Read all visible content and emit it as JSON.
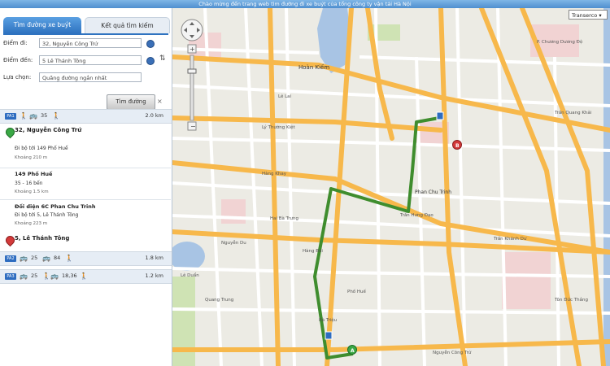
{
  "header": {
    "welcome": "Chào mừng đến trang web tìm đường đi xe buýt của tổng công ty vận tải Hà Nội"
  },
  "tabs": [
    {
      "label": "Tìm đường xe buýt"
    },
    {
      "label": "Kết quả tìm kiếm"
    }
  ],
  "form": {
    "from_label": "Điểm đi:",
    "from_value": "32, Nguyễn Công Trứ",
    "to_label": "Điểm đến:",
    "to_value": "5 Lê Thánh Tông",
    "option_label": "Lựa chọn:",
    "option_value": "Quãng đường ngắn nhất",
    "find_button": "Tìm đường",
    "close": "×",
    "swap": "⇅"
  },
  "routes": [
    {
      "badge": "PA1",
      "bus": "35",
      "distance": "2.0 km"
    },
    {
      "badge": "PA2",
      "bus": "25",
      "bus2": "84",
      "distance": "1.8 km"
    },
    {
      "badge": "PA3",
      "bus": "25",
      "bus2": "18,36",
      "distance": "1.2 km"
    }
  ],
  "steps": {
    "start_title": "32, Nguyễn Công Trứ",
    "walk1": "Đi bộ tới 149 Phố Huế",
    "walk1_dist": "Khoảng 210 m",
    "stop1_title": "149 Phố Huế",
    "bus1": "35 - 16 bến",
    "bus1_dist": "Khoảng 1.5 km",
    "stop2_title": "Đối diện 6C Phan Chu Trinh",
    "walk2": "Đi bộ tới 5, Lê Thánh Tông",
    "walk2_dist": "Khoảng 223 m",
    "end_title": "5, Lê Thánh Tông"
  },
  "map": {
    "operator_select": "Transerco",
    "labels": {
      "hoan_kiem": "Hoàn Kiếm",
      "phan_chu_trinh": "Phan Chu Trinh",
      "tran_hung_dao": "Trần Hưng Đạo",
      "nguyen_cong_tru": "Nguyễn Công Trứ",
      "chuong_duong": "P. Chương Dương Độ",
      "quang_trung": "Quang Trung",
      "hai_ba_trung": "Hai Bà Trưng",
      "tran_quang_khai": "Trần Quang Khải",
      "ly_thuong_kiet": "Lý Thường Kiệt",
      "ba_trieu": "Bà Triệu",
      "pho_hue": "Phố Huế",
      "le_duan": "Lê Duẩn",
      "hang_bai": "Hàng Bài",
      "tran_khanh_du": "Trần Khánh Dư",
      "ton_duc_thang": "Tôn Đức Thắng",
      "nguyen_du": "Nguyễn Du",
      "le_lai": "Lê Lai",
      "hang_khay": "Hàng Khay"
    },
    "pinA": "A",
    "pinB": "B"
  },
  "colors": {
    "accent": "#2f73c0",
    "route": "#3f8d2e",
    "major_road": "#f7b84b",
    "minor_road": "#ffffff",
    "water": "#a8c4e4"
  },
  "icons": [
    "walk-icon",
    "bus-icon",
    "gear-icon",
    "swap-icon",
    "close-icon",
    "pan-control",
    "zoom-slider"
  ]
}
